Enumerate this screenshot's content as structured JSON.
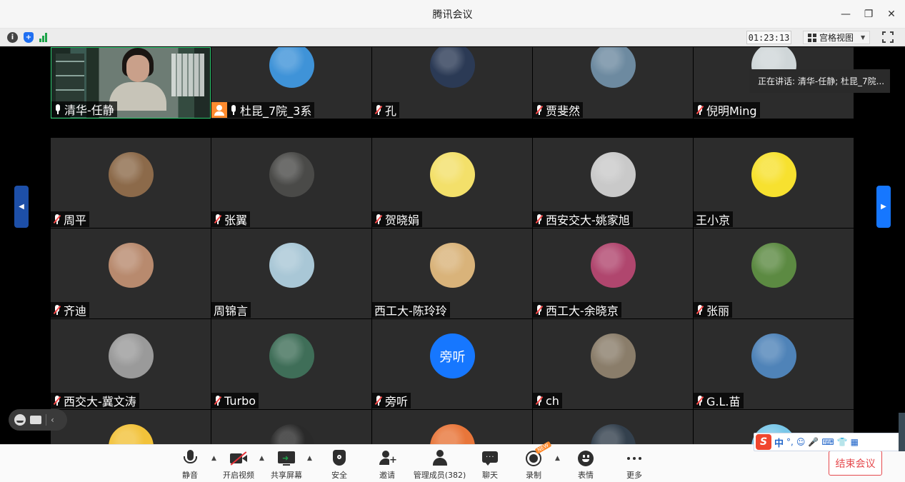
{
  "window": {
    "title": "腾讯会议",
    "minimize_glyph": "—",
    "restore_glyph": "❐",
    "close_glyph": "✕"
  },
  "infobar": {
    "icons": [
      "info-icon",
      "shield-icon",
      "signal-icon"
    ],
    "timer": "01:23:13",
    "view_mode": "宫格视图"
  },
  "speaking_tooltip": "正在讲话: 清华-任静; 杜昆_7院...",
  "participants": [
    {
      "name": "清华-任静",
      "mic": "on",
      "video": true
    },
    {
      "name": "杜昆_7院_3系",
      "mic": "on",
      "host": true,
      "avatar_color": "#3f93d8"
    },
    {
      "name": "孔",
      "mic": "muted",
      "avatar_color": "#2b3a55"
    },
    {
      "name": "贾斐然",
      "mic": "muted",
      "avatar_color": "#6d8aa0"
    },
    {
      "name": "倪明Ming",
      "mic": "muted",
      "avatar_color": "#cfd6d8"
    },
    {
      "name": "周平",
      "mic": "muted",
      "avatar_color": "#8c6a4a"
    },
    {
      "name": "张翼",
      "mic": "muted",
      "avatar_color": "#4a4a48"
    },
    {
      "name": "贺晓娟",
      "mic": "muted",
      "avatar_color": "#f3e06a"
    },
    {
      "name": "西安交大-姚家旭",
      "mic": "muted",
      "avatar_color": "#c9c9c9"
    },
    {
      "name": "王小京",
      "mic": "none",
      "avatar_color": "#f7e12f"
    },
    {
      "name": "齐迪",
      "mic": "muted",
      "avatar_color": "#b88a6e"
    },
    {
      "name": "周锦言",
      "mic": "none",
      "avatar_color": "#a9c7d6"
    },
    {
      "name": "西工大-陈玲玲",
      "mic": "none",
      "avatar_color": "#d9b37a"
    },
    {
      "name": "西工大-余晓京",
      "mic": "muted",
      "avatar_color": "#b0466e"
    },
    {
      "name": "张丽",
      "mic": "muted",
      "avatar_color": "#5c8a42"
    },
    {
      "name": "西交大-冀文涛",
      "mic": "muted",
      "avatar_color": "#9a9a9a"
    },
    {
      "name": "Turbo",
      "mic": "muted",
      "avatar_color": "#3f6e58"
    },
    {
      "name": "旁听",
      "mic": "muted",
      "avatar_text": "旁听",
      "avatar_color": "#1677ff"
    },
    {
      "name": "ch",
      "mic": "muted",
      "avatar_color": "#8a7d6a"
    },
    {
      "name": "G.L.苗",
      "mic": "muted",
      "avatar_color": "#4f83b8"
    },
    {
      "name": "",
      "mic": "none",
      "avatar_color": "#f2c23a"
    },
    {
      "name": "",
      "mic": "none",
      "avatar_color": "#2a2a2a"
    },
    {
      "name": "",
      "mic": "none",
      "avatar_color": "#e8763a"
    },
    {
      "name": "",
      "mic": "none",
      "avatar_color": "#33404d"
    },
    {
      "name": "",
      "mic": "none",
      "avatar_color": "#78c6e8"
    }
  ],
  "toolbar": {
    "items": [
      {
        "id": "mute",
        "label": "静音",
        "icon": "mic-icon"
      },
      {
        "id": "video",
        "label": "开启视频",
        "icon": "camera-off-icon"
      },
      {
        "id": "share",
        "label": "共享屏幕",
        "icon": "share-screen-icon"
      },
      {
        "id": "security",
        "label": "安全",
        "icon": "shield-icon"
      },
      {
        "id": "invite",
        "label": "邀请",
        "icon": "add-user-icon"
      },
      {
        "id": "members",
        "label": "管理成员(382)",
        "icon": "members-icon"
      },
      {
        "id": "chat",
        "label": "聊天",
        "icon": "chat-icon"
      },
      {
        "id": "record",
        "label": "录制",
        "icon": "record-icon",
        "badge": "NEW"
      },
      {
        "id": "emoji",
        "label": "表情",
        "icon": "emoji-icon"
      },
      {
        "id": "more",
        "label": "更多",
        "icon": "more-icon"
      }
    ],
    "end_meeting": "结束会议"
  },
  "ime": {
    "logo": "S",
    "mode": "中",
    "punct": "°,",
    "glyphs": [
      "☺",
      "🎤",
      "⌨",
      "👕",
      "▦"
    ]
  },
  "colors": {
    "accent": "#1677ff",
    "danger": "#e5494d",
    "host_badge": "#ff8b2e",
    "tile_bg": "#2c2c2c"
  }
}
